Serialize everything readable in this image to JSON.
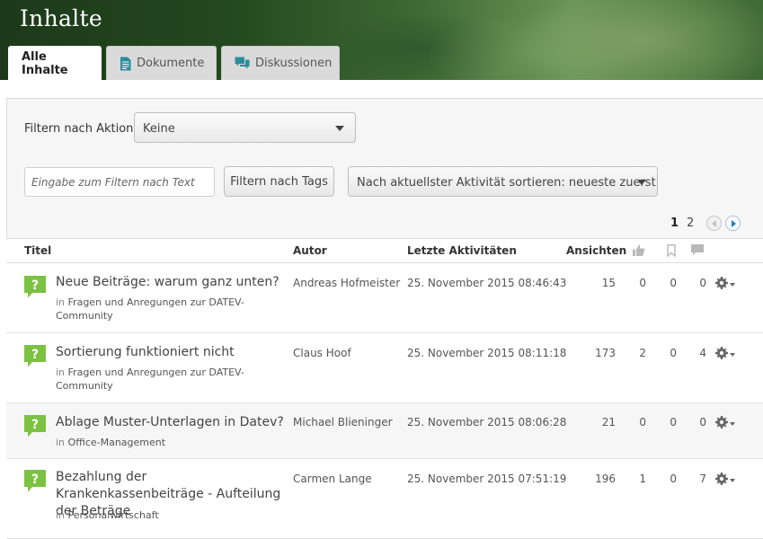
{
  "header": {
    "title": "Inhalte",
    "tabs": [
      {
        "label": "Alle Inhalte",
        "icon": "none",
        "active": true
      },
      {
        "label": "Dokumente",
        "icon": "document-icon",
        "active": false
      },
      {
        "label": "Diskussionen",
        "icon": "discussion-icon",
        "active": false
      }
    ]
  },
  "filters": {
    "action_label": "Filtern nach Aktion:",
    "action_selected": "Keine",
    "text_placeholder": "Eingabe zum Filtern nach Text",
    "tags_button": "Filtern nach Tags",
    "sort_selected": "Nach aktuellster Aktivität sortieren: neueste zuerst"
  },
  "pagination": {
    "pages": [
      "1",
      "2"
    ],
    "current": "1"
  },
  "table": {
    "headers": {
      "title": "Titel",
      "author": "Autor",
      "activity": "Letzte Aktivitäten",
      "views": "Ansichten"
    },
    "header_icons": [
      "thumbs-up-icon",
      "bookmark-icon",
      "comment-icon"
    ],
    "rows": [
      {
        "title": "Neue Beiträge: warum ganz unten?",
        "in": "in",
        "place": "Fragen und Anregungen zur DATEV-Community",
        "author": "Andreas Hofmeister",
        "date": "25. November 2015 08:46:43",
        "views": "15",
        "likes": "0",
        "bookmarks": "0",
        "comments": "0"
      },
      {
        "title": "Sortierung funktioniert nicht",
        "in": "in",
        "place": "Fragen und Anregungen zur DATEV-Community",
        "author": "Claus Hoof",
        "date": "25. November 2015 08:11:18",
        "views": "173",
        "likes": "2",
        "bookmarks": "0",
        "comments": "4"
      },
      {
        "title": "Ablage Muster-Unterlagen in Datev?",
        "in": "in",
        "place": "Office-Management",
        "author": "Michael Blieninger",
        "date": "25. November 2015 08:06:28",
        "views": "21",
        "likes": "0",
        "bookmarks": "0",
        "comments": "0"
      },
      {
        "title": "Bezahlung der Krankenkassenbeiträge - Aufteilung der Beträge",
        "in": "in",
        "place": "Personalwirtschaft",
        "author": "Carmen Lange",
        "date": "25. November 2015 07:51:19",
        "views": "196",
        "likes": "1",
        "bookmarks": "0",
        "comments": "7"
      }
    ]
  },
  "colors": {
    "question_icon": "#7cc242",
    "tab_icon": "#2a8c9c",
    "pager_arrow": "#1a7bbf"
  }
}
